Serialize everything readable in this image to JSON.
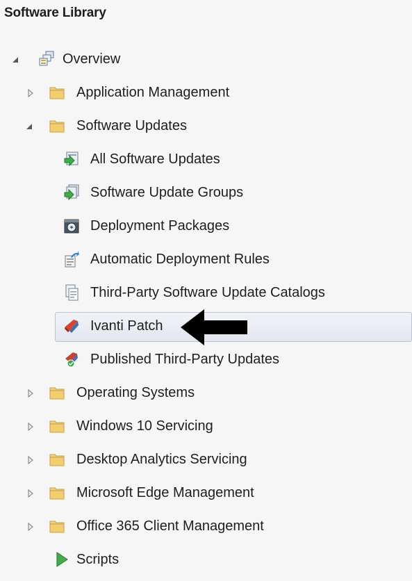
{
  "panel": {
    "title": "Software Library"
  },
  "tree": {
    "overview": "Overview",
    "application_management": "Application Management",
    "software_updates": "Software Updates",
    "all_software_updates": "All Software Updates",
    "software_update_groups": "Software Update Groups",
    "deployment_packages": "Deployment Packages",
    "automatic_deployment_rules": "Automatic Deployment Rules",
    "third_party_catalogs": "Third-Party Software Update Catalogs",
    "ivanti_patch": "Ivanti Patch",
    "published_third_party_updates": "Published Third-Party Updates",
    "operating_systems": "Operating Systems",
    "windows_10_servicing": "Windows 10 Servicing",
    "desktop_analytics_servicing": "Desktop Analytics Servicing",
    "microsoft_edge_management": "Microsoft Edge Management",
    "office_365_client_management": "Office 365 Client Management",
    "scripts": "Scripts"
  },
  "selected_item": "ivanti_patch",
  "colors": {
    "panel_background": "#f6f6f6",
    "folder": "#f1cf6e",
    "selection_border": "#b9c3d1",
    "pointer_arrow": "#000000"
  }
}
